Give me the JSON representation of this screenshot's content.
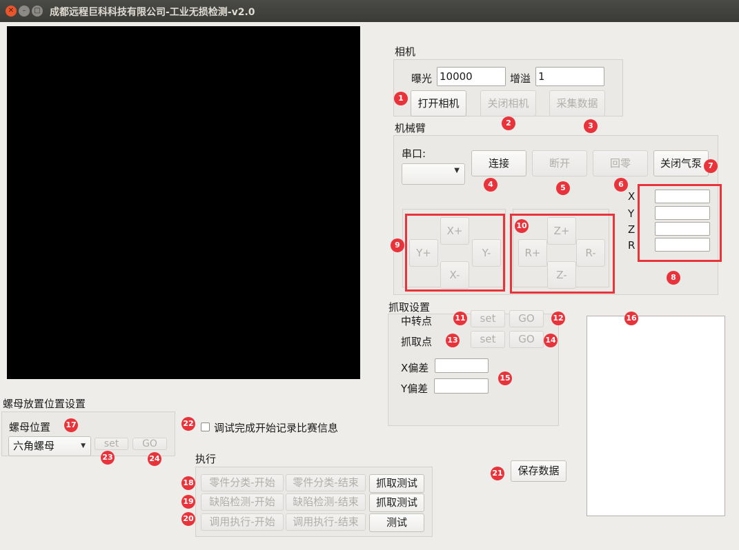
{
  "window": {
    "title": "成都远程巨科科技有限公司-工业无损检测-v2.0"
  },
  "camera": {
    "group_label": "相机",
    "exposure_label": "曝光",
    "exposure_value": "10000",
    "gain_label": "增溢",
    "gain_value": "1",
    "open_label": "打开相机",
    "close_label": "关闭相机",
    "capture_label": "采集数据"
  },
  "arm": {
    "group_label": "机械臂",
    "serial_label": "串口:",
    "connect_label": "连接",
    "disconnect_label": "断开",
    "home_label": "回零",
    "pump_label": "关闭气泵",
    "coords": [
      {
        "label": "X",
        "value": ""
      },
      {
        "label": "Y",
        "value": ""
      },
      {
        "label": "Z",
        "value": ""
      },
      {
        "label": "R",
        "value": ""
      }
    ],
    "xy_pad": {
      "x_plus": "X+",
      "x_minus": "X-",
      "y_plus": "Y+",
      "y_minus": "Y-"
    },
    "zr_pad": {
      "z_plus": "Z+",
      "z_minus": "Z-",
      "r_plus": "R+",
      "r_minus": "R-"
    }
  },
  "grab": {
    "group_label": "抓取设置",
    "transfer_label": "中转点",
    "grab_point_label": "抓取点",
    "set_label": "set",
    "go_label": "GO",
    "x_offset_label": "X偏差",
    "y_offset_label": "Y偏差",
    "x_offset_value": "",
    "y_offset_value": ""
  },
  "nut": {
    "group_label": "螺母放置位置设置",
    "position_label": "螺母位置",
    "selected": "六角螺母",
    "set_label": "set",
    "go_label": "GO"
  },
  "debug_checkbox_label": "调试完成开始记录比赛信息",
  "execute": {
    "group_label": "执行",
    "rows": [
      {
        "start": "零件分类-开始",
        "end": "零件分类-结束",
        "action": "抓取测试"
      },
      {
        "start": "缺陷检测-开始",
        "end": "缺陷检测-结束",
        "action": "抓取测试"
      },
      {
        "start": "调用执行-开始",
        "end": "调用执行-结束",
        "action": "测试"
      }
    ]
  },
  "save_label": "保存数据",
  "annotations": [
    "1",
    "2",
    "3",
    "4",
    "5",
    "6",
    "7",
    "8",
    "9",
    "10",
    "11",
    "12",
    "13",
    "14",
    "15",
    "16",
    "17",
    "18",
    "19",
    "20",
    "21",
    "22",
    "23",
    "24"
  ],
  "colors": {
    "titlebar": "#3e3e3b",
    "window_bg": "#efedea",
    "annotation_red": "#e8333b",
    "video_bg": "#000000"
  }
}
